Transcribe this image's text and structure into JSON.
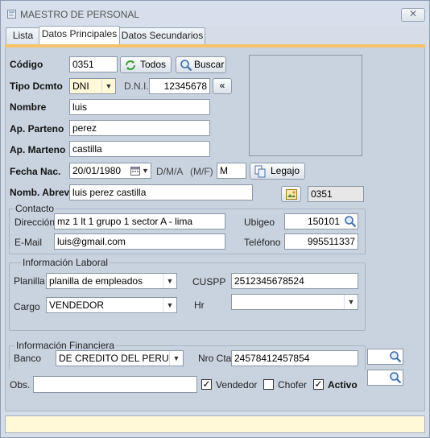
{
  "window": {
    "title": "MAESTRO DE PERSONAL",
    "close_glyph": "✕"
  },
  "tabs": [
    {
      "label": "Lista"
    },
    {
      "label": "Datos Principales"
    },
    {
      "label": "Datos Secundarios"
    }
  ],
  "form": {
    "codigo_label": "Código",
    "codigo_value": "0351",
    "todos_label": "Todos",
    "buscar_label": "Buscar",
    "tipo_label": "Tipo Dcmto",
    "tipo_value": "DNI",
    "dni_label": "D.N.I.",
    "dni_value": "12345678",
    "back_glyph": "«",
    "nombre_label": "Nombre",
    "nombre_value": "luis",
    "paterno_label": "Ap. Parteno",
    "paterno_value": "perez",
    "materno_label": "Ap. Marteno",
    "materno_value": "castilla",
    "fecha_label": "Fecha Nac.",
    "fecha_value": "20/01/1980",
    "fecha_format": "D/M/A",
    "sexo_label": "(M/F)",
    "sexo_value": "M",
    "legajo_label": "Legajo",
    "abrev_label": "Nomb. Abrev",
    "abrev_value": "luis perez castilla",
    "code_display": "0351"
  },
  "contacto": {
    "title": "Contacto",
    "direccion_label": "Dirección",
    "direccion_value": "mz 1 lt 1 grupo 1 sector A - lima",
    "ubigeo_label": "Ubigeo",
    "ubigeo_value": "150101",
    "email_label": "E-Mail",
    "email_value": "luis@gmail.com",
    "telefono_label": "Teléfono",
    "telefono_value": "995511337"
  },
  "laboral": {
    "title": "Información Laboral",
    "planilla_label": "Planilla",
    "planilla_value": "planilla de empleados",
    "cuspp_label": "CUSPP",
    "cuspp_value": "2512345678524",
    "cargo_label": "Cargo",
    "cargo_value": "VENDEDOR",
    "hr_label": "Hr",
    "hr_value": ""
  },
  "financiera": {
    "title": "Información Financiera",
    "banco_label": "Banco",
    "banco_value": "DE CREDITO DEL PERU",
    "cta_label": "Nro Cta",
    "cta_value": "24578412457854"
  },
  "bottom": {
    "obs_label": "Obs.",
    "obs_value": "",
    "vendedor_label": "Vendedor",
    "vendedor_checked": true,
    "chofer_label": "Chofer",
    "chofer_checked": false,
    "activo_label": "Activo",
    "activo_checked": true
  },
  "icons": {
    "app": "form-icon",
    "todos": "refresh-icon",
    "buscar": "magnifier-icon",
    "calendar": "calendar-icon",
    "legajo": "copy-document-icon",
    "photo": "image-icon",
    "search": "magnifier-icon"
  },
  "colors": {
    "accent": "#f6c36b",
    "panel": "#c9d3e0",
    "status_bar": "#fff9d8"
  }
}
